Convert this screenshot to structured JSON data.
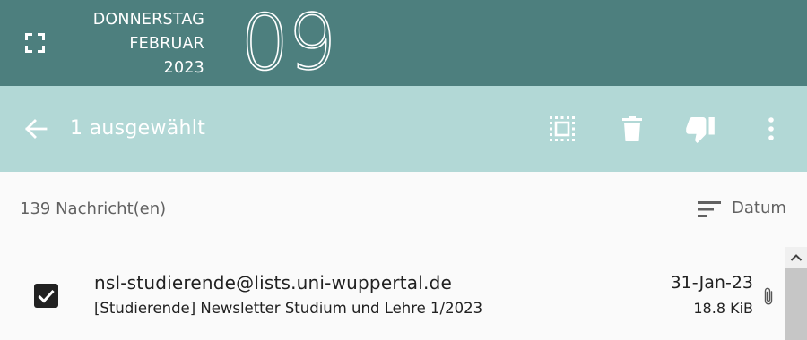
{
  "date_header": {
    "weekday": "DONNERSTAG",
    "month": "FEBRUAR",
    "year": "2023",
    "day": "09"
  },
  "action_bar": {
    "title": "1 ausgewählt",
    "icons": [
      "back-arrow-icon",
      "select-all-icon",
      "delete-icon",
      "thumbs-down-icon",
      "more-vert-icon"
    ]
  },
  "list_header": {
    "count": "139 Nachricht(en)",
    "sort_label": "Datum"
  },
  "messages": [
    {
      "sender": "nsl-studierende@lists.uni-wuppertal.de",
      "subject": "[Studierende] Newsletter Studium und Lehre 1/2023",
      "date": "31-Jan-23",
      "size": "18.8 KiB",
      "selected": true,
      "has_attachment": true
    }
  ],
  "colors": {
    "date_header_bg": "#4d7f7e",
    "action_bar_bg": "#b2d8d6",
    "list_bg": "#fafafa",
    "text_primary": "#212121",
    "text_secondary": "#616161"
  }
}
